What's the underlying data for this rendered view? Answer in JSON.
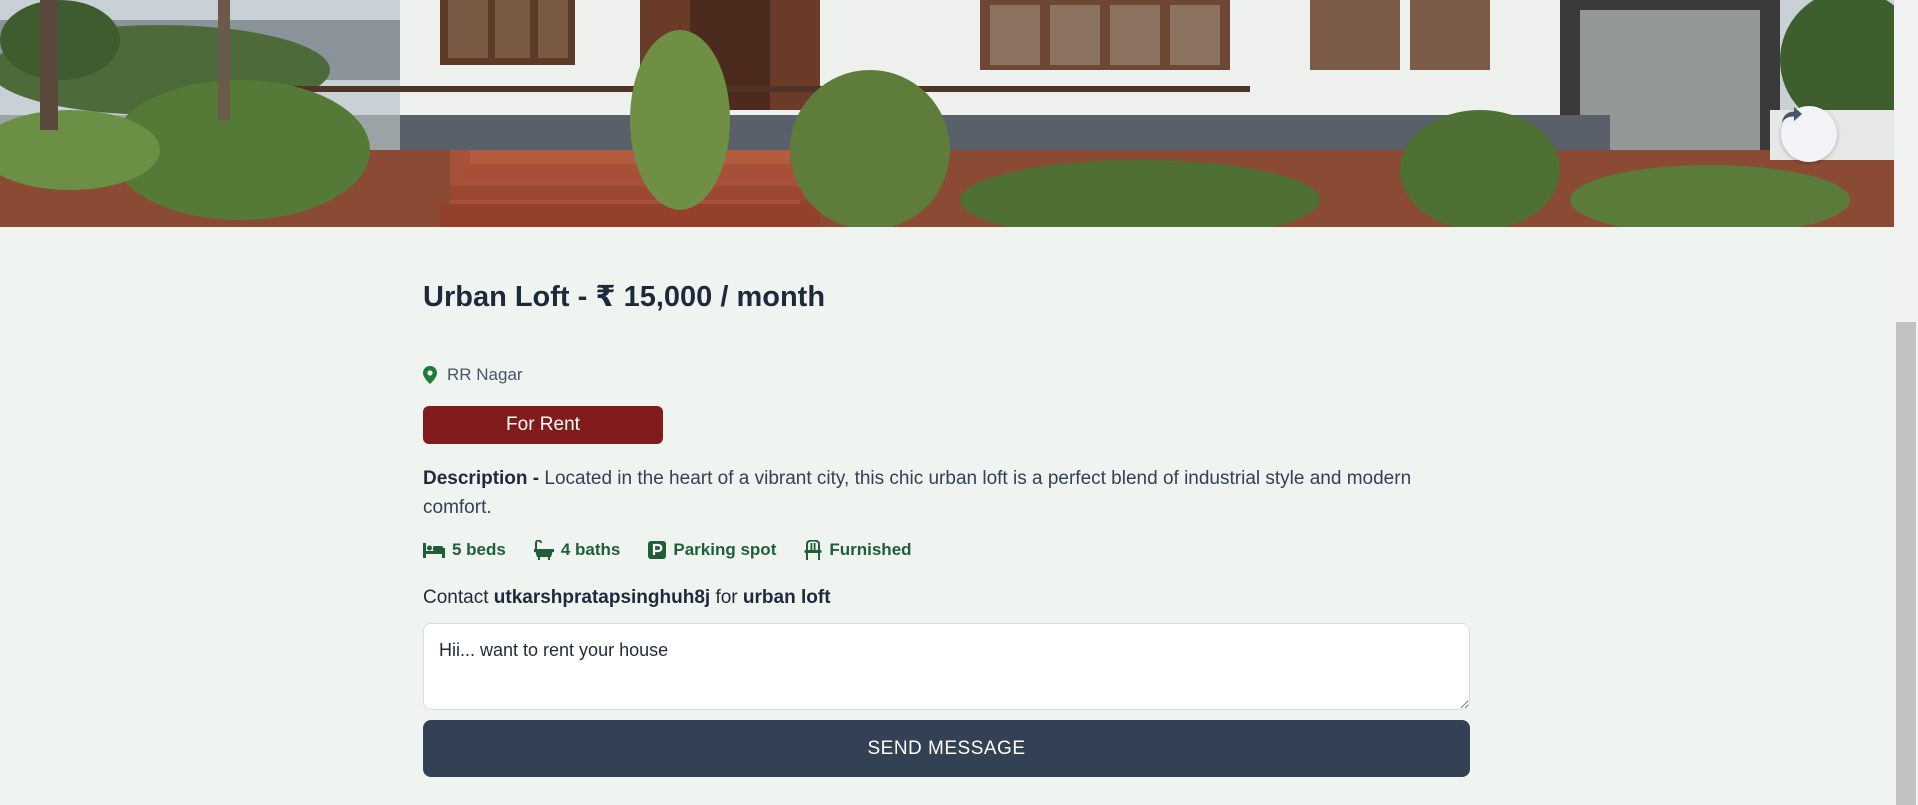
{
  "listing": {
    "title": "Urban Loft - ₹ 15,000 / month",
    "location": "RR Nagar",
    "type_badge": "For Rent",
    "description_label": "Description - ",
    "description": "Located in the heart of a vibrant city, this chic urban loft is a perfect blend of industrial style and modern comfort.",
    "features": {
      "beds": "5 beds",
      "baths": "4 baths",
      "parking": "Parking spot",
      "furnished": "Furnished"
    },
    "icons": [
      "map-pin-icon",
      "bed-icon",
      "bath-icon",
      "parking-icon",
      "chair-icon",
      "share-icon"
    ]
  },
  "contact": {
    "prefix": "Contact ",
    "owner": "utkarshpratapsinghuh8j",
    "middle": " for ",
    "listing_name": "urban loft",
    "message": "Hii... want to rent your house",
    "send_label": "SEND MESSAGE"
  },
  "colors": {
    "page_bg": "#f0f4f1",
    "badge_bg": "#821c1c",
    "feature_green": "#1f5f38",
    "button_bg": "#334155"
  }
}
